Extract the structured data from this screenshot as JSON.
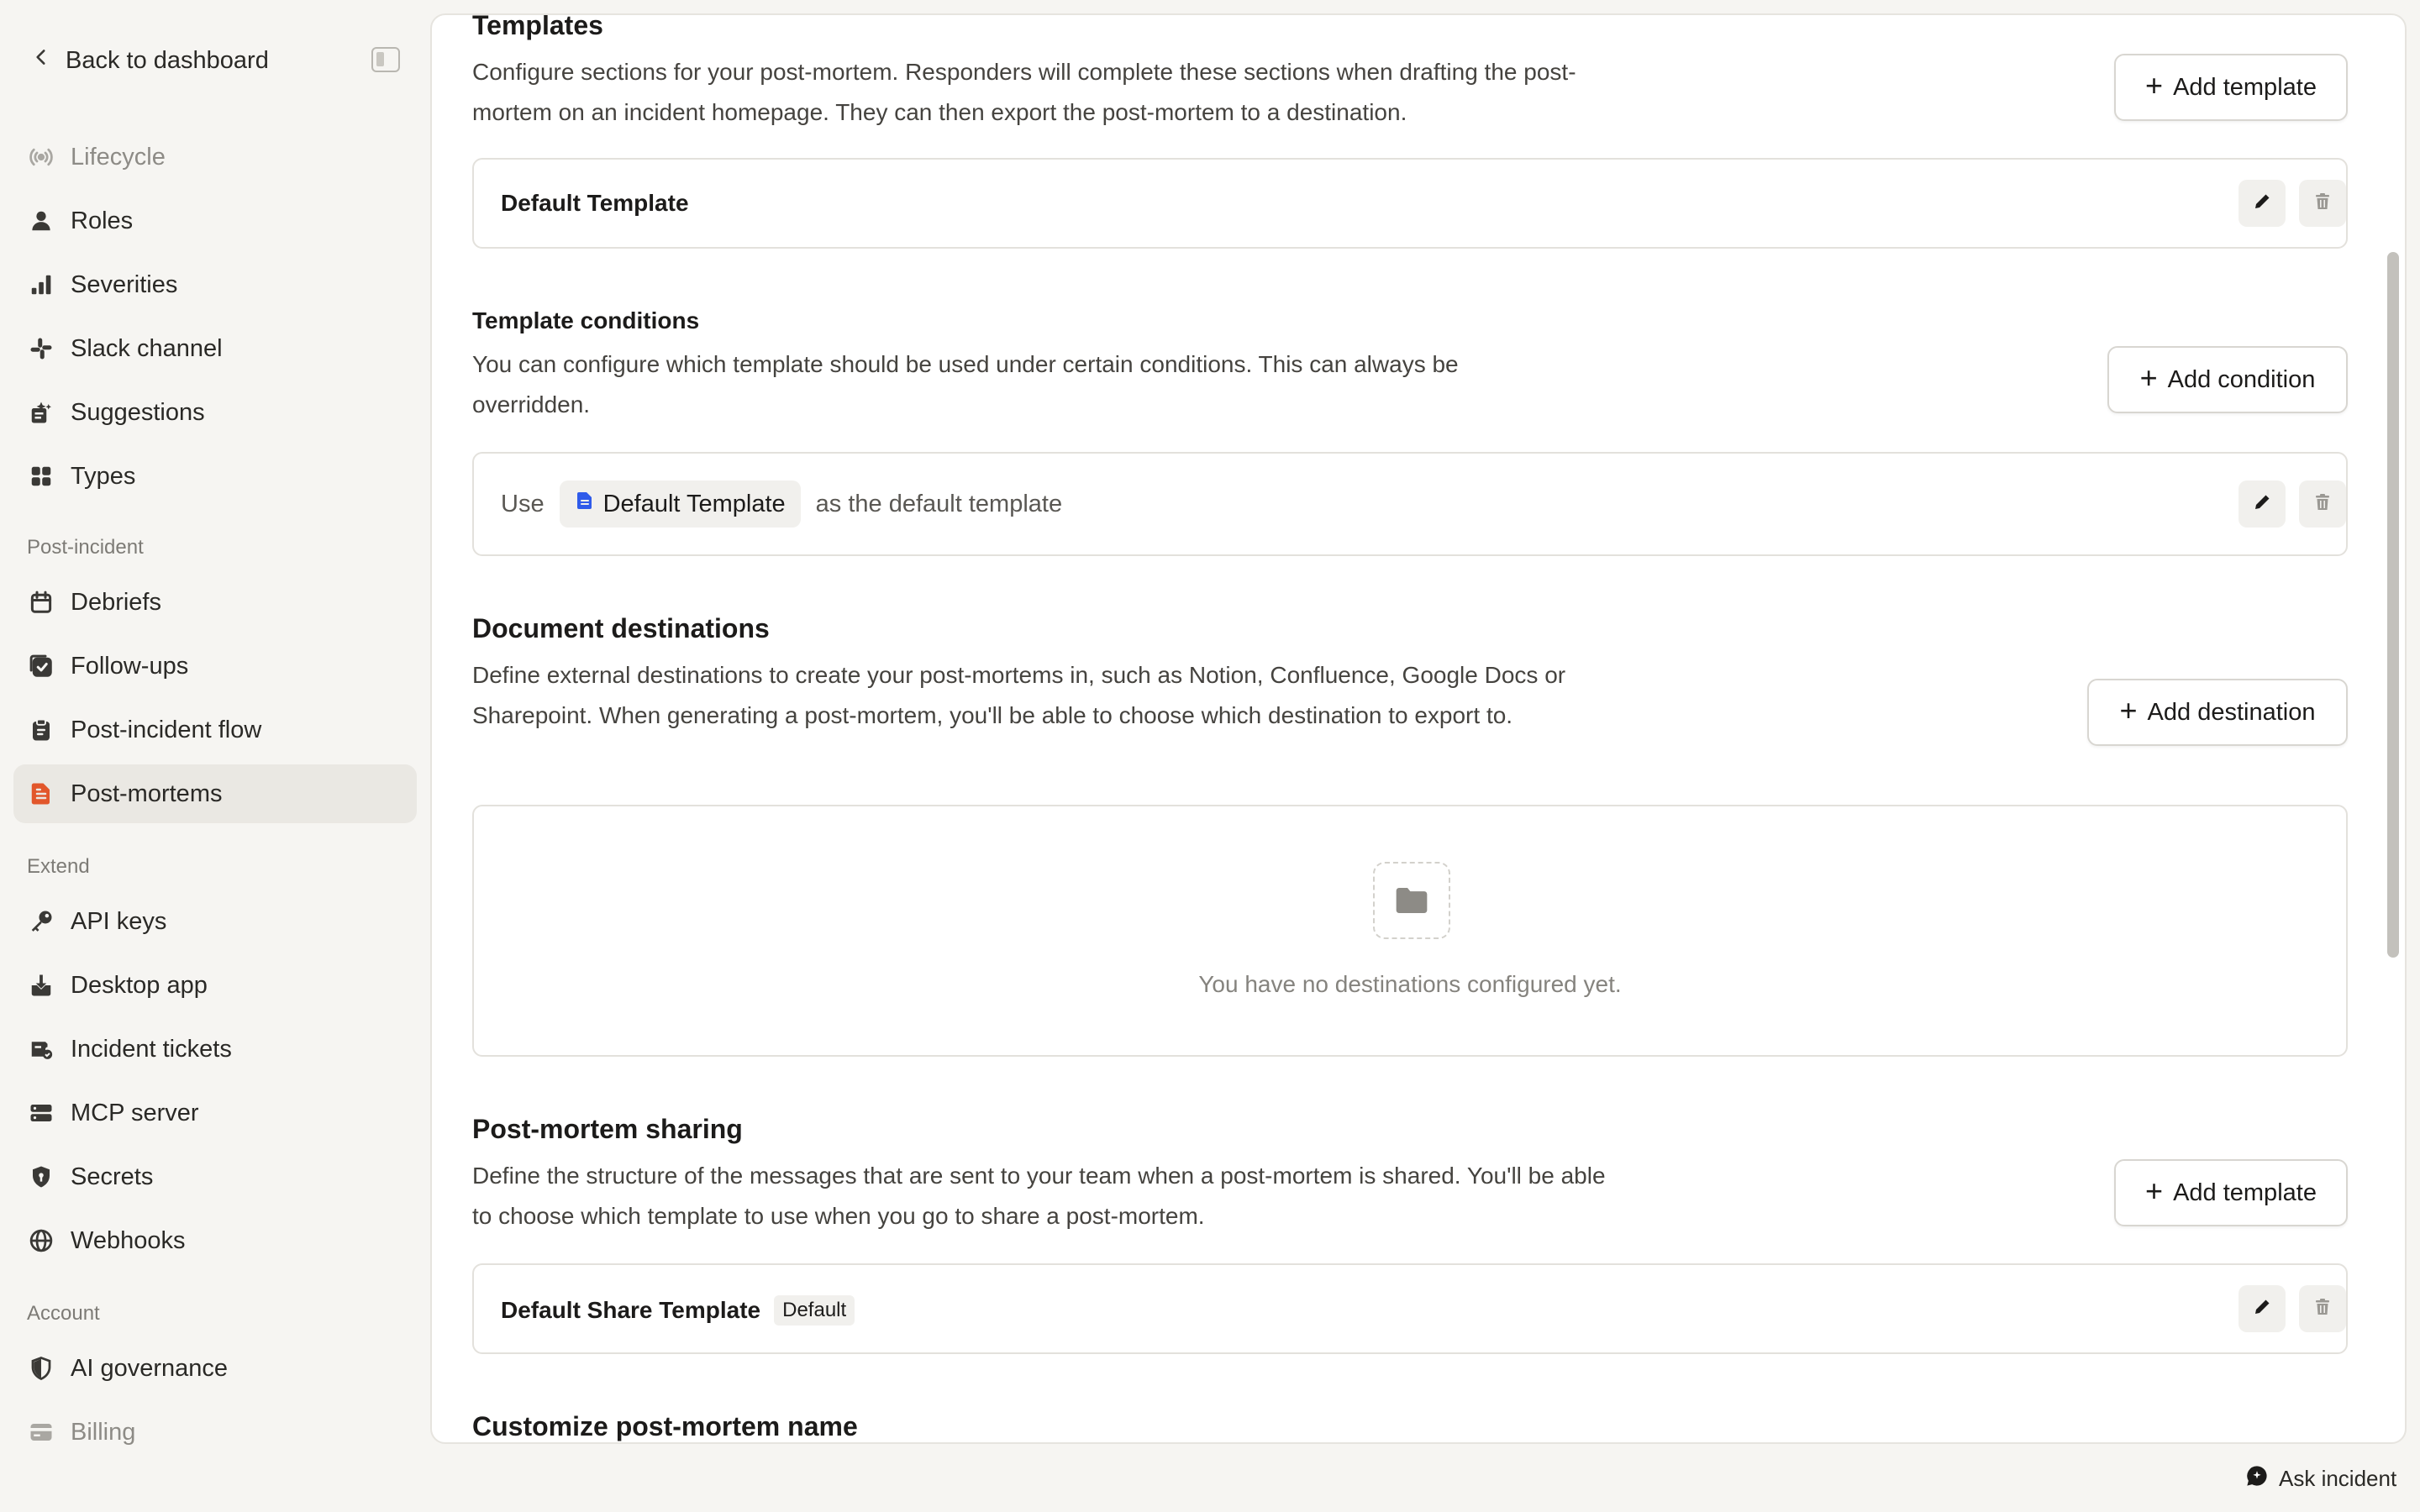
{
  "sidebar": {
    "back_label": "Back to dashboard",
    "top_items": [
      {
        "label": "Lifecycle",
        "icon": "radio-signal-icon"
      },
      {
        "label": "Roles",
        "icon": "person-icon"
      },
      {
        "label": "Severities",
        "icon": "bar-chart-icon"
      },
      {
        "label": "Slack channel",
        "icon": "slack-icon"
      },
      {
        "label": "Suggestions",
        "icon": "suggestions-icon"
      },
      {
        "label": "Types",
        "icon": "grid-icon"
      }
    ],
    "section_post_incident": "Post-incident",
    "post_incident_items": [
      {
        "label": "Debriefs",
        "icon": "calendar-icon"
      },
      {
        "label": "Follow-ups",
        "icon": "checkbox-icon"
      },
      {
        "label": "Post-incident flow",
        "icon": "clipboard-icon"
      },
      {
        "label": "Post-mortems",
        "icon": "document-icon",
        "active": true
      }
    ],
    "section_extend": "Extend",
    "extend_items": [
      {
        "label": "API keys",
        "icon": "key-icon"
      },
      {
        "label": "Desktop app",
        "icon": "download-icon"
      },
      {
        "label": "Incident tickets",
        "icon": "ticket-icon"
      },
      {
        "label": "MCP server",
        "icon": "server-icon"
      },
      {
        "label": "Secrets",
        "icon": "shield-lock-icon"
      },
      {
        "label": "Webhooks",
        "icon": "globe-icon"
      }
    ],
    "section_account": "Account",
    "account_items": [
      {
        "label": "AI governance",
        "icon": "shield-half-icon"
      },
      {
        "label": "Billing",
        "icon": "credit-card-icon"
      }
    ]
  },
  "templates": {
    "title": "Templates",
    "description": "Configure sections for your post-mortem. Responders will complete these sections when drafting the post-mortem on an incident homepage. They can then export the post-mortem to a destination.",
    "add_label": "Add template",
    "items": [
      {
        "name": "Default Template"
      }
    ]
  },
  "conditions": {
    "title": "Template conditions",
    "description": "You can configure which template should be used under certain conditions. This can always be overridden.",
    "add_label": "Add condition",
    "row": {
      "prefix": "Use",
      "template": "Default Template",
      "suffix": "as the default template"
    }
  },
  "destinations": {
    "title": "Document destinations",
    "description": "Define external destinations to create your post-mortems in, such as Notion, Confluence, Google Docs or Sharepoint. When generating a post-mortem, you'll be able to choose which destination to export to.",
    "add_label": "Add destination",
    "empty_text": "You have no destinations configured yet."
  },
  "sharing": {
    "title": "Post-mortem sharing",
    "description": "Define the structure of the messages that are sent to your team when a post-mortem is shared. You'll be able to choose which template to use when you go to share a post-mortem.",
    "add_label": "Add template",
    "items": [
      {
        "name": "Default Share Template",
        "badge": "Default"
      }
    ]
  },
  "naming": {
    "title": "Customize post-mortem name"
  },
  "footer": {
    "ask_label": "Ask incident"
  },
  "colors": {
    "accent": "#e2572b",
    "chip_icon": "#2f5bea"
  }
}
